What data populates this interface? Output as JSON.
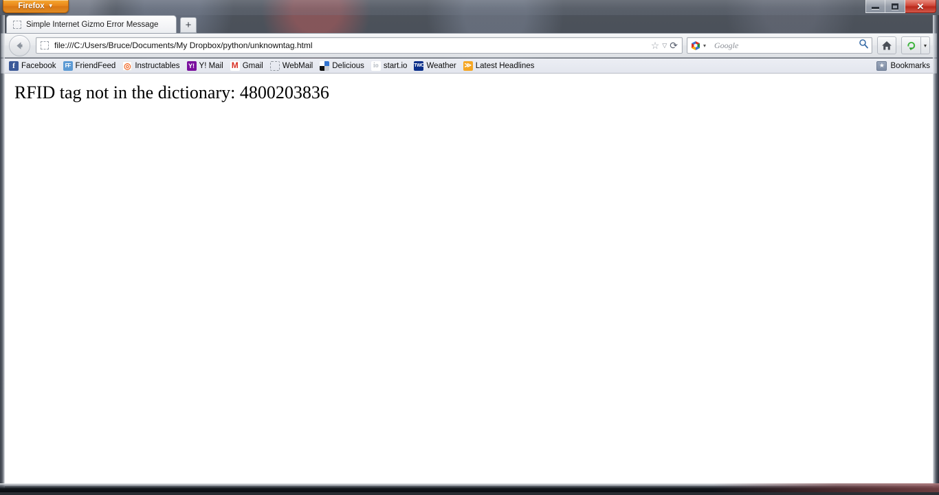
{
  "window": {
    "app_button_label": "Firefox",
    "app_button_caret": "▼",
    "controls": {
      "minimize": "minimize",
      "maximize": "restore",
      "close": "✕"
    }
  },
  "tabs": {
    "active_title": "Simple Internet Gizmo Error Message",
    "favicon": "dashed-placeholder-icon",
    "new_tab_label": "+"
  },
  "toolbar": {
    "back_icon": "back-arrow-icon",
    "url": "file:///C:/Users/Bruce/Documents/My Dropbox/python/unknowntag.html",
    "identity_icon": "dashed-placeholder-icon",
    "bookmark_star_icon": "☆",
    "dropdown_icon": "▽",
    "reload_icon": "⟳",
    "search_engine": "Google",
    "search_placeholder": "Google",
    "search_icon": "magnifier-icon",
    "home_icon": "home-icon",
    "download_icon": "download-arrow-icon",
    "download_dropdown_icon": "▾"
  },
  "bookmarks": {
    "items": [
      {
        "label": "Facebook",
        "icon": "facebook-icon",
        "glyph": "f"
      },
      {
        "label": "FriendFeed",
        "icon": "friendfeed-icon",
        "glyph": "FF"
      },
      {
        "label": "Instructables",
        "icon": "instructables-icon",
        "glyph": "◎"
      },
      {
        "label": "Y! Mail",
        "icon": "yahoo-mail-icon",
        "glyph": "Y!"
      },
      {
        "label": "Gmail",
        "icon": "gmail-icon",
        "glyph": "M"
      },
      {
        "label": "WebMail",
        "icon": "dashed-placeholder-icon",
        "glyph": ""
      },
      {
        "label": "Delicious",
        "icon": "delicious-icon",
        "glyph": ""
      },
      {
        "label": "start.io",
        "icon": "startio-icon",
        "glyph": "io"
      },
      {
        "label": "Weather",
        "icon": "weather-channel-icon",
        "glyph": "TWC"
      },
      {
        "label": "Latest Headlines",
        "icon": "rss-feed-icon",
        "glyph": "≫"
      }
    ],
    "menu_label": "Bookmarks",
    "menu_icon": "star-folder-icon",
    "menu_glyph": "★"
  },
  "page": {
    "body_text": "RFID tag not in the dictionary: 4800203836"
  },
  "colors": {
    "firefox_orange": "#e8851a",
    "close_red": "#c0392b",
    "toolbar_grey": "#e9ebee",
    "bookmark_bar": "#e6e9f0",
    "page_background": "#ffffff",
    "page_text": "#000000"
  }
}
